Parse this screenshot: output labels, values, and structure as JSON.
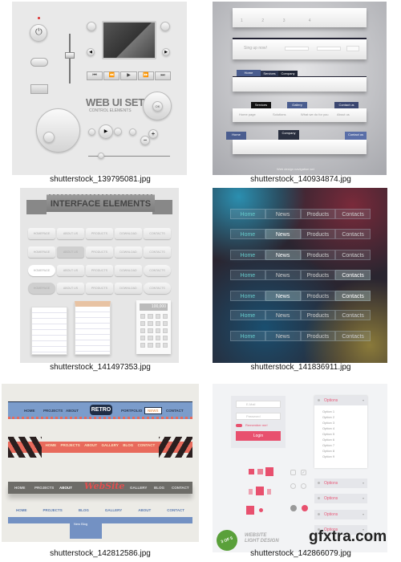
{
  "thumbnails": [
    {
      "caption": "shutterstock_139795081.jpg",
      "title": "WEB UI SET",
      "subtitle": "CONTROL ELEMENTS",
      "ok_label": "OK"
    },
    {
      "caption": "shutterstock_140934874.jpg",
      "tabs": [
        "Home",
        "Services",
        "Company",
        "Gallery",
        "Contact us"
      ],
      "signup": "Sing up now!",
      "steps": [
        "Home page",
        "Solutions",
        "What we do for you",
        "About us"
      ],
      "footer": "Web design navigation set"
    },
    {
      "caption": "shutterstock_141497353.jpg",
      "banner": "INTERFACE ELEMENTS",
      "buttons": [
        "HOMEPAGE",
        "ABOUT US",
        "PRODUCTS",
        "DOWNLOAD",
        "CONTACTS"
      ],
      "calc_display": "100,000"
    },
    {
      "caption": "shutterstock_141836911.jpg",
      "nav": [
        "Home",
        "News",
        "Products",
        "Contacts"
      ]
    },
    {
      "caption": "shutterstock_142812586.jpg",
      "row1": [
        "HOME",
        "PROJECTS",
        "ABOUT",
        "RETRO",
        "PORTFOLIO",
        "NEWS",
        "CONTACT"
      ],
      "row2": [
        "HOME",
        "PROJECTS",
        "ABOUT",
        "GALLERY",
        "BLOG",
        "CONTACT"
      ],
      "row3": [
        "HOME",
        "PROJECTS",
        "ABOUT",
        "WebSite",
        "GALLERY",
        "BLOG",
        "CONTACT"
      ],
      "row4": [
        "HOME",
        "PROJECTS",
        "BLOG",
        "GALLERY",
        "ABOUT",
        "CONTACT"
      ],
      "dropdown": "New Blog"
    },
    {
      "caption": "shutterstock_142866079.jpg",
      "email_placeholder": "E-Mail",
      "password_placeholder": "Password",
      "remember": "Remember me!",
      "login": "Login",
      "options_label": "Options",
      "options": [
        "Option 1",
        "Option 2",
        "Option 3",
        "Option 4",
        "Option 5",
        "Option 6",
        "Option 7",
        "Option 8",
        "Option 9"
      ],
      "badge": "3 OF 5",
      "brand_line1": "WEBSITE",
      "brand_line2": "LIGHT DESIGN",
      "accent": "#e8506e"
    }
  ],
  "watermark": "gfxtra.com"
}
